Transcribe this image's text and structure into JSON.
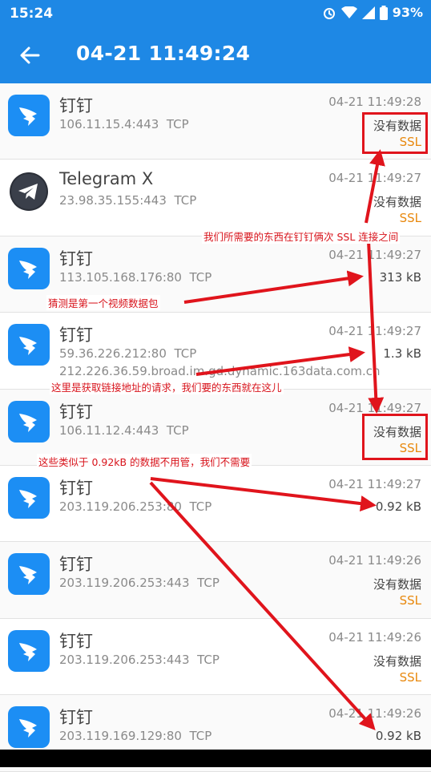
{
  "status_bar": {
    "time": "15:24",
    "battery": "93%"
  },
  "header": {
    "title": "04-21 11:49:24"
  },
  "rows": [
    {
      "app": "钉钉",
      "address": "106.11.15.4:443",
      "protocol": "TCP",
      "time": "04-21 11:49:28",
      "data": "没有数据",
      "tag": "SSL",
      "icon": "dingtalk-icon"
    },
    {
      "app": "Telegram X",
      "address": "23.98.35.155:443",
      "protocol": "TCP",
      "time": "04-21 11:49:27",
      "data": "没有数据",
      "tag": "SSL",
      "icon": "telegram-icon"
    },
    {
      "app": "钉钉",
      "address": "113.105.168.176:80",
      "protocol": "TCP",
      "time": "04-21 11:49:27",
      "data": "313 kB",
      "tag": "",
      "icon": "dingtalk-icon"
    },
    {
      "app": "钉钉",
      "address": "59.36.226.212:80",
      "protocol": "TCP",
      "time": "04-21 11:49:27",
      "data": "1.3 kB",
      "tag": "",
      "host": "212.226.36.59.broad.im.gd.dynamic.163data.com.cn",
      "icon": "dingtalk-icon"
    },
    {
      "app": "钉钉",
      "address": "106.11.12.4:443",
      "protocol": "TCP",
      "time": "04-21 11:49:27",
      "data": "没有数据",
      "tag": "SSL",
      "icon": "dingtalk-icon"
    },
    {
      "app": "钉钉",
      "address": "203.119.206.253:80",
      "protocol": "TCP",
      "time": "04-21 11:49:27",
      "data": "0.92 kB",
      "tag": "",
      "icon": "dingtalk-icon"
    },
    {
      "app": "钉钉",
      "address": "203.119.206.253:443",
      "protocol": "TCP",
      "time": "04-21 11:49:26",
      "data": "没有数据",
      "tag": "SSL",
      "icon": "dingtalk-icon"
    },
    {
      "app": "钉钉",
      "address": "203.119.206.253:443",
      "protocol": "TCP",
      "time": "04-21 11:49:26",
      "data": "没有数据",
      "tag": "SSL",
      "icon": "dingtalk-icon"
    },
    {
      "app": "钉钉",
      "address": "203.119.169.129:80",
      "protocol": "TCP",
      "time": "04-21 11:49:26",
      "data": "0.92 kB",
      "tag": "",
      "icon": "dingtalk-icon"
    }
  ],
  "annotations": {
    "ssl_between": "我们所需要的东西在钉钉俩次 SSL 连接之间",
    "first_video": "猜测是第一个视频数据包",
    "link_request": "这里是获取链接地址的请求，我们要的东西就在这儿",
    "ignore_small": "这些类似于 0.92kB 的数据不用管，我们不需要"
  },
  "colors": {
    "primary": "#1e88e5",
    "annotation": "#e0141c",
    "ssl": "#e8880d"
  }
}
